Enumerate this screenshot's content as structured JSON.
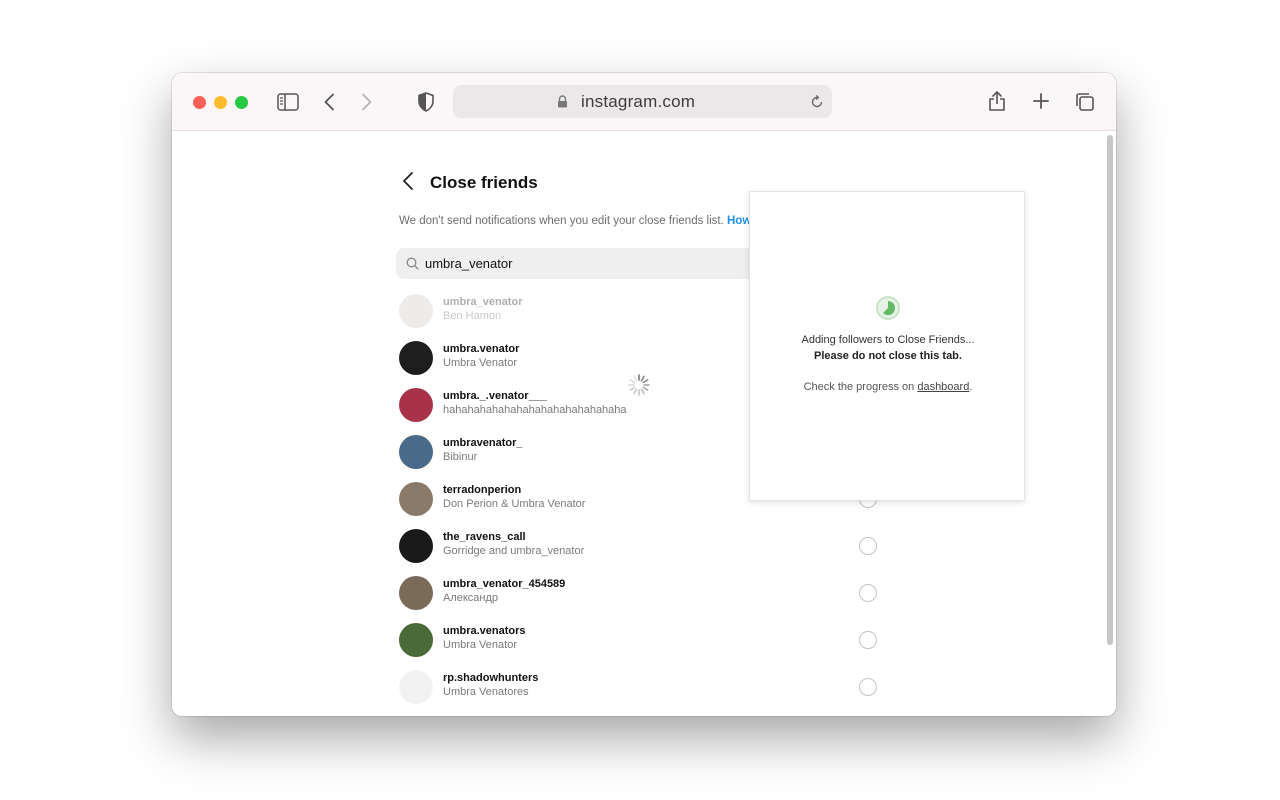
{
  "browser": {
    "url": "instagram.com"
  },
  "page": {
    "title": "Close friends",
    "notice": "We don't send notifications when you edit your close friends list.",
    "notice_link": "How"
  },
  "search": {
    "value": "umbra_venator"
  },
  "users": [
    {
      "username": "umbra_venator",
      "fullname": "Ben Hamon",
      "avatar_color": "#d8d4d0",
      "pending": true
    },
    {
      "username": "umbra.venator",
      "fullname": "Umbra Venator",
      "avatar_color": "#1e1e1e"
    },
    {
      "username": "umbra._.venator___",
      "fullname": "hahahahahahahahahahahahahahaha",
      "avatar_color": "#a8324a"
    },
    {
      "username": "umbravenator_",
      "fullname": "Bibinur",
      "avatar_color": "#4a6a8a"
    },
    {
      "username": "terradonperion",
      "fullname": "Don Perion & Umbra Venator",
      "avatar_color": "#8a7a6a"
    },
    {
      "username": "the_ravens_call",
      "fullname": "Gorridge and umbra_venator",
      "avatar_color": "#1a1a1a"
    },
    {
      "username": "umbra_venator_454589",
      "fullname": "Александр",
      "avatar_color": "#7a6a58"
    },
    {
      "username": "umbra.venators",
      "fullname": "Umbra Venator",
      "avatar_color": "#4a6a3a"
    },
    {
      "username": "rp.shadowhunters",
      "fullname": "Umbra Venatores",
      "avatar_color": "#f2f2f2"
    }
  ],
  "popup": {
    "line1": "Adding followers to Close Friends...",
    "line2": "Please do not close this tab.",
    "line3_prefix": "Check the progress on ",
    "line3_link": "dashboard",
    "line3_suffix": "."
  },
  "colors": {
    "link_blue": "#1f8ee8",
    "progress_green": "#4caf50"
  }
}
